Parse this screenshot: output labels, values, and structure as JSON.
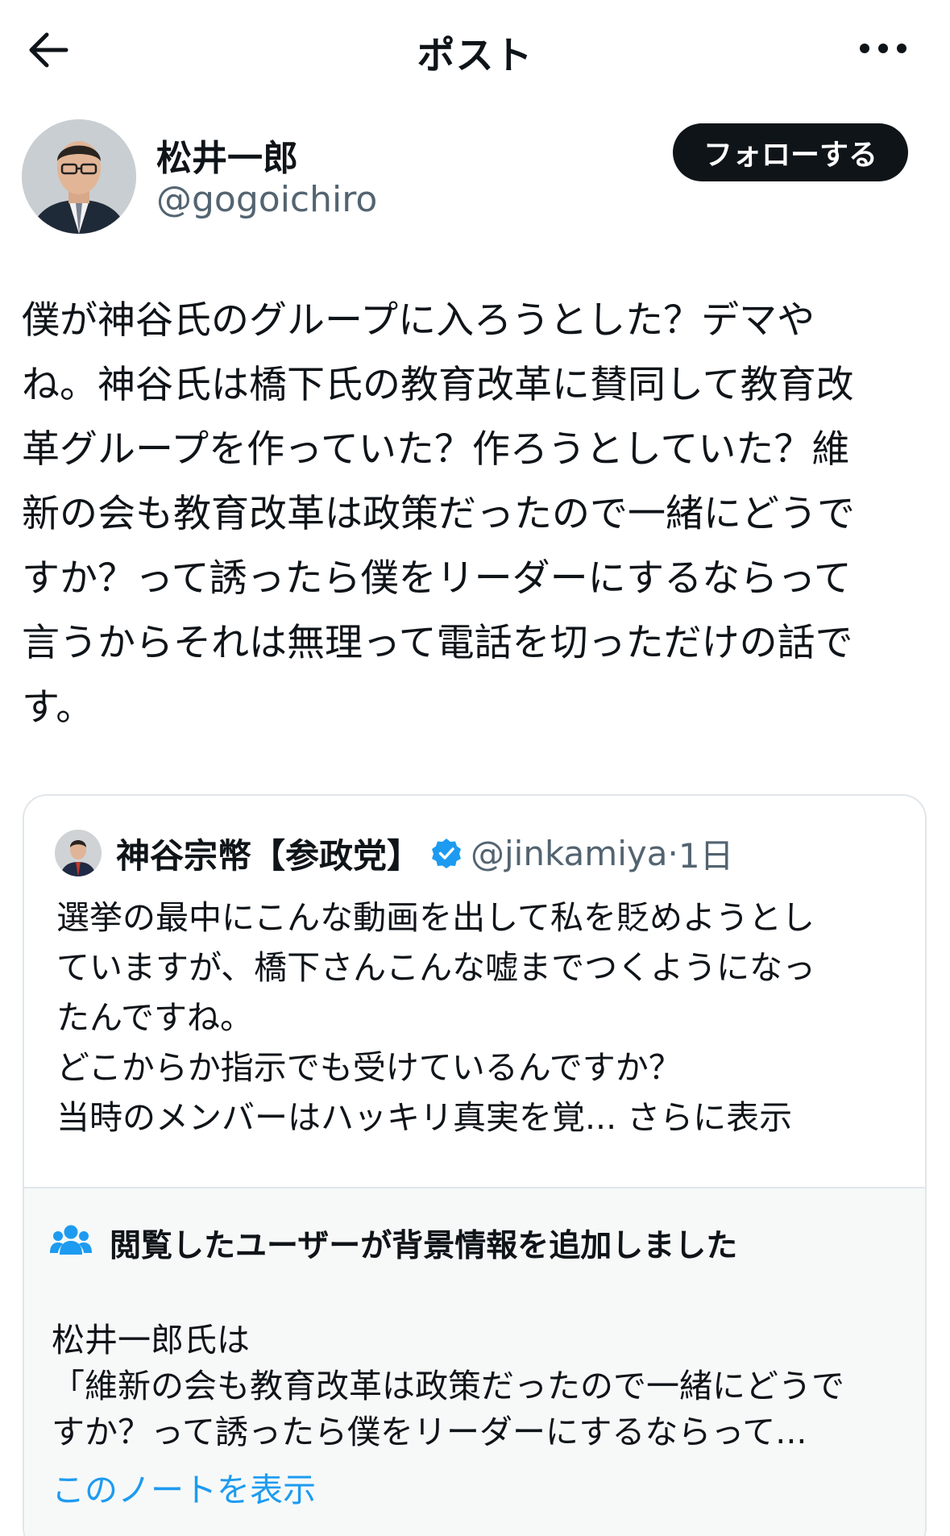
{
  "header": {
    "title": "ポスト"
  },
  "author": {
    "name": "松井一郎",
    "handle": "@gogoichiro",
    "follow_label": "フォローする"
  },
  "post": {
    "text": "僕が神谷氏のグループに入ろうとした？デマや\nね。神谷氏は橋下氏の教育改革に賛同して教育改\n革グループを作っていた？作ろうとしていた？維\n新の会も教育改革は政策だったので一緒にどうで\nすか？って誘ったら僕をリーダーにするならって\n言うからそれは無理って電話を切っただけの話で\nす。"
  },
  "quote": {
    "name": "神谷宗幣【参政党】",
    "handle": "@jinkamiya",
    "separator": "·",
    "time": "1日",
    "text": "選挙の最中にこんな動画を出して私を貶めようとし\nていますが、橋下さんこんな嘘までつくようになっ\nたんですね。\nどこからか指示でも受けているんですか？\n当時のメンバーはハッキリ真実を覚... ",
    "show_more": "さらに表示"
  },
  "community_note": {
    "heading": "閲覧したユーザーが背景情報を追加しました",
    "text": "松井一郎氏は\n「維新の会も教育改革は政策だったので一緒にどうで\nすか？って誘ったら僕をリーダーにするならって...",
    "link": "このノートを表示"
  },
  "colors": {
    "text": "#0f1419",
    "secondary": "#536471",
    "link": "#1d9bf0",
    "verified": "#1d9bf0",
    "note_background": "#f7f9f9"
  }
}
